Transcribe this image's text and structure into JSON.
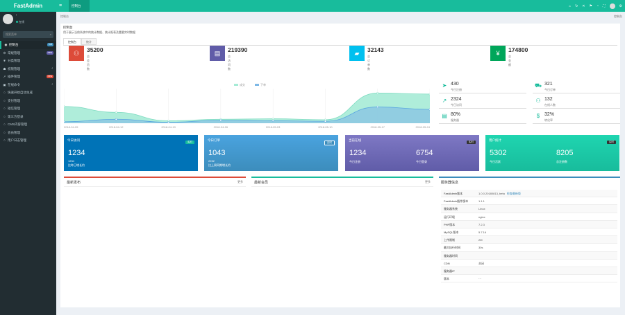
{
  "app": {
    "name": "FastAdmin"
  },
  "user": {
    "name": "'",
    "status": "在线"
  },
  "sidebar": {
    "search_placeholder": "搜索菜单",
    "items": [
      {
        "label": "控制台",
        "icon": "dashboard-icon",
        "badge": "hot",
        "badge_color": "#3c8dbc"
      },
      {
        "label": "常规管理",
        "icon": "cogs-icon",
        "badge": "new",
        "badge_color": "#605ca8"
      },
      {
        "label": "分类管理",
        "icon": "leaf-icon",
        "badge": ""
      },
      {
        "label": "权限管理",
        "icon": "group-icon",
        "badge": ""
      },
      {
        "label": "插件管理",
        "icon": "rocket-icon",
        "badge": "new",
        "badge_color": "#dd4b39"
      },
      {
        "label": "在线命令",
        "icon": "terminal-icon",
        "badge": ""
      },
      {
        "label": "快速开始自动生成",
        "icon": "circle-icon",
        "badge": ""
      },
      {
        "label": "支付管理",
        "icon": "circle-icon",
        "badge": ""
      },
      {
        "label": "短信管理",
        "icon": "circle-icon",
        "badge": ""
      },
      {
        "label": "第三方登录",
        "icon": "circle-icon",
        "badge": ""
      },
      {
        "label": "CMS内容管理",
        "icon": "circle-icon",
        "badge": ""
      },
      {
        "label": "会员管理",
        "icon": "circle-icon",
        "badge": ""
      },
      {
        "label": "用户日志管理",
        "icon": "circle-icon",
        "badge": ""
      }
    ]
  },
  "topbar": {
    "tab_label": "控制台"
  },
  "breadcrumb": {
    "path": "控制台",
    "right": "控制台"
  },
  "panel": {
    "heading": "控制台",
    "subheading": "用于展示当前系统中的统计数据、统计报表及重要实时数据",
    "tabs": [
      {
        "label": "控制台"
      },
      {
        "label": "统计"
      }
    ]
  },
  "stats": [
    {
      "value": "35200",
      "label": "总会员数",
      "color": "#dd4b39",
      "icon": "users-icon"
    },
    {
      "value": "219390",
      "label": "总访问数",
      "color": "#605ca8",
      "icon": "book-icon"
    },
    {
      "value": "32143",
      "label": "总订单数",
      "color": "#00c0ef",
      "icon": "shopping-bag-icon"
    },
    {
      "value": "174800",
      "label": "总金额",
      "color": "#00a65a",
      "icon": "yen-icon"
    }
  ],
  "chart_data": {
    "type": "area",
    "legend": [
      "成交",
      "下单"
    ],
    "x": [
      "2018-04-05",
      "2018-04-12",
      "2018-04-19",
      "2018-04-26",
      "2018-05-03",
      "2018-05-10",
      "2018-05-17",
      "2018-05-24"
    ],
    "series": [
      {
        "name": "成交",
        "values": [
          340,
          220,
          50,
          80,
          90,
          70,
          610,
          590
        ]
      },
      {
        "name": "下单",
        "values": [
          30,
          80,
          20,
          60,
          50,
          40,
          330,
          280
        ]
      }
    ],
    "ylim": [
      0,
      700
    ],
    "colors": [
      "#a6ebd6",
      "#7db8e6"
    ]
  },
  "side_stats": [
    {
      "value": "430",
      "label": "今日注册",
      "icon": "send-icon",
      "color": "#18bc9c"
    },
    {
      "value": "321",
      "label": "今日订单",
      "icon": "cart-icon",
      "color": "#18bc9c"
    },
    {
      "value": "2324",
      "label": "今日访问",
      "icon": "trending-icon",
      "color": "#18bc9c"
    },
    {
      "value": "132",
      "label": "在线人数",
      "icon": "users-icon",
      "color": "#18bc9c"
    },
    {
      "value": "80%",
      "label": "服务器",
      "icon": "server-icon",
      "color": "#18bc9c"
    },
    {
      "value": "32%",
      "label": "转化率",
      "icon": "dollar-icon",
      "color": "#18bc9c"
    }
  ],
  "cards": [
    {
      "title": "今日访问",
      "tag": "实时",
      "value": "1234",
      "sub1": "1234",
      "sub2": "比昨日增长约",
      "color": "#0073b7"
    },
    {
      "title": "今日订单",
      "tag": "实时",
      "value": "1043",
      "sub1": "2232",
      "sub2": "比上周同期增长约",
      "color": "#3c8dbc"
    },
    {
      "title": "当前在线",
      "tag": "实时",
      "value": "1234",
      "value2": "6754",
      "sub1": "今日注册",
      "sub2": "今日登录",
      "color": "#605ca8"
    },
    {
      "title": "用户统计",
      "tag": "实时",
      "value": "5302",
      "value2": "8205",
      "sub1": "今日活跃",
      "sub2": "总注册数",
      "color": "#18bc9c"
    }
  ],
  "boxes": [
    {
      "title": "最新发布",
      "right": "更多",
      "color": "#dd4b39"
    },
    {
      "title": "最新会员",
      "right": "更多",
      "color": "#18bc9c"
    }
  ],
  "sysinfo": {
    "title": "服务器信息",
    "rows": [
      {
        "k": "FastAdmin版本",
        "v": "1.0.0.20180813_beta",
        "link": "检查最新版"
      },
      {
        "k": "FastAdmin插件版本",
        "v": "1.1.1"
      },
      {
        "k": "服务器系统",
        "v": "Linux"
      },
      {
        "k": "运行环境",
        "v": "nginx"
      },
      {
        "k": "PHP版本",
        "v": "7.2.3"
      },
      {
        "k": "MySQL版本",
        "v": "5.7.16"
      },
      {
        "k": "上传限制",
        "v": "2M"
      },
      {
        "k": "最大执行时间",
        "v": "30s"
      },
      {
        "k": "服务器时间",
        "v": ""
      },
      {
        "k": "CDN",
        "v": "关闭"
      },
      {
        "k": "服务器IP",
        "v": ""
      },
      {
        "k": "版本",
        "v": "···"
      }
    ]
  }
}
